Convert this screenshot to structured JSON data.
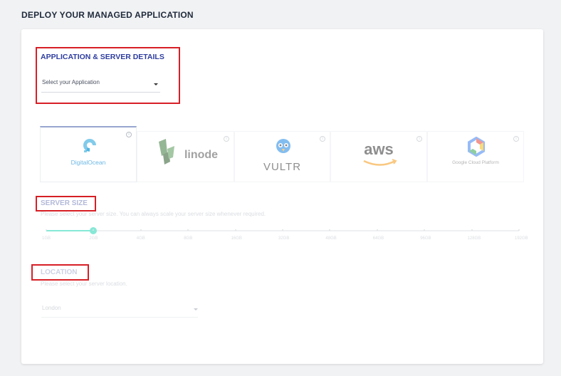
{
  "page": {
    "title": "DEPLOY YOUR MANAGED APPLICATION"
  },
  "app_section": {
    "heading": "APPLICATION & SERVER DETAILS",
    "select_placeholder": "Select your Application"
  },
  "providers": [
    {
      "name": "DigitalOcean",
      "icon": "digitalocean-logo",
      "active": true
    },
    {
      "name": "linode",
      "icon": "linode-logo",
      "active": false
    },
    {
      "name": "VULTR",
      "icon": "vultr-logo",
      "active": false
    },
    {
      "name": "aws",
      "icon": "aws-logo",
      "active": false
    },
    {
      "name": "Google Cloud Platform",
      "icon": "google-cloud-logo",
      "active": false
    }
  ],
  "server_size": {
    "heading": "SERVER SIZE",
    "hint": "Please select your server size. You can always scale your server size whenever required.",
    "selected_index": 1,
    "options": [
      "1GB",
      "2GB",
      "4GB",
      "8GB",
      "16GB",
      "32GB",
      "48GB",
      "64GB",
      "96GB",
      "128GB",
      "192GB"
    ]
  },
  "location": {
    "heading": "LOCATION",
    "hint": "Please select your server location.",
    "value": "London"
  },
  "colors": {
    "accent": "#2e3d9f",
    "highlight": "#d71f26",
    "slider": "#86e8d6"
  }
}
